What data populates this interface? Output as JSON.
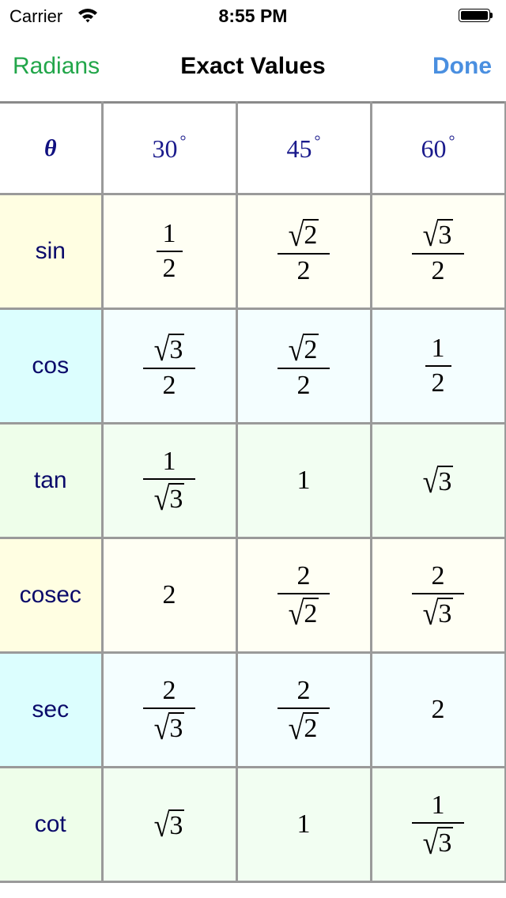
{
  "status_bar": {
    "carrier": "Carrier",
    "time": "8:55 PM",
    "wifi_icon": "wifi-icon",
    "battery_icon": "battery-full-icon",
    "battery_level": 1.0
  },
  "nav": {
    "left_button": "Radians",
    "title": "Exact Values",
    "right_button": "Done",
    "left_color": "#22a64a",
    "right_color": "#4a8fe0"
  },
  "table": {
    "header": {
      "theta": "θ",
      "angles": [
        {
          "value": "30",
          "unit": "°"
        },
        {
          "value": "45",
          "unit": "°"
        },
        {
          "value": "60",
          "unit": "°"
        }
      ]
    },
    "rows": [
      {
        "fn": "sin",
        "bg": "#fffee2",
        "cell_bg": "#fffff4",
        "values": [
          {
            "type": "frac",
            "num": "1",
            "num_sqrt": false,
            "den": "2",
            "den_sqrt": false
          },
          {
            "type": "frac",
            "num": "2",
            "num_sqrt": true,
            "den": "2",
            "den_sqrt": false
          },
          {
            "type": "frac",
            "num": "3",
            "num_sqrt": true,
            "den": "2",
            "den_sqrt": false
          }
        ]
      },
      {
        "fn": "cos",
        "bg": "#dcfefe",
        "cell_bg": "#f4feff",
        "values": [
          {
            "type": "frac",
            "num": "3",
            "num_sqrt": true,
            "den": "2",
            "den_sqrt": false
          },
          {
            "type": "frac",
            "num": "2",
            "num_sqrt": true,
            "den": "2",
            "den_sqrt": false
          },
          {
            "type": "frac",
            "num": "1",
            "num_sqrt": false,
            "den": "2",
            "den_sqrt": false
          }
        ]
      },
      {
        "fn": "tan",
        "bg": "#eefeea",
        "cell_bg": "#f2fef2",
        "values": [
          {
            "type": "frac",
            "num": "1",
            "num_sqrt": false,
            "den": "3",
            "den_sqrt": true
          },
          {
            "type": "plain",
            "text": "1"
          },
          {
            "type": "sqrt",
            "text": "3"
          }
        ]
      },
      {
        "fn": "cosec",
        "bg": "#fffee2",
        "cell_bg": "#fffff4",
        "values": [
          {
            "type": "plain",
            "text": "2"
          },
          {
            "type": "frac",
            "num": "2",
            "num_sqrt": false,
            "den": "2",
            "den_sqrt": true
          },
          {
            "type": "frac",
            "num": "2",
            "num_sqrt": false,
            "den": "3",
            "den_sqrt": true
          }
        ]
      },
      {
        "fn": "sec",
        "bg": "#dcfefe",
        "cell_bg": "#f4feff",
        "values": [
          {
            "type": "frac",
            "num": "2",
            "num_sqrt": false,
            "den": "3",
            "den_sqrt": true
          },
          {
            "type": "frac",
            "num": "2",
            "num_sqrt": false,
            "den": "2",
            "den_sqrt": true
          },
          {
            "type": "plain",
            "text": "2"
          }
        ]
      },
      {
        "fn": "cot",
        "bg": "#eefeea",
        "cell_bg": "#f2fef2",
        "values": [
          {
            "type": "sqrt",
            "text": "3"
          },
          {
            "type": "plain",
            "text": "1"
          },
          {
            "type": "frac",
            "num": "1",
            "num_sqrt": false,
            "den": "3",
            "den_sqrt": true
          }
        ]
      }
    ]
  }
}
